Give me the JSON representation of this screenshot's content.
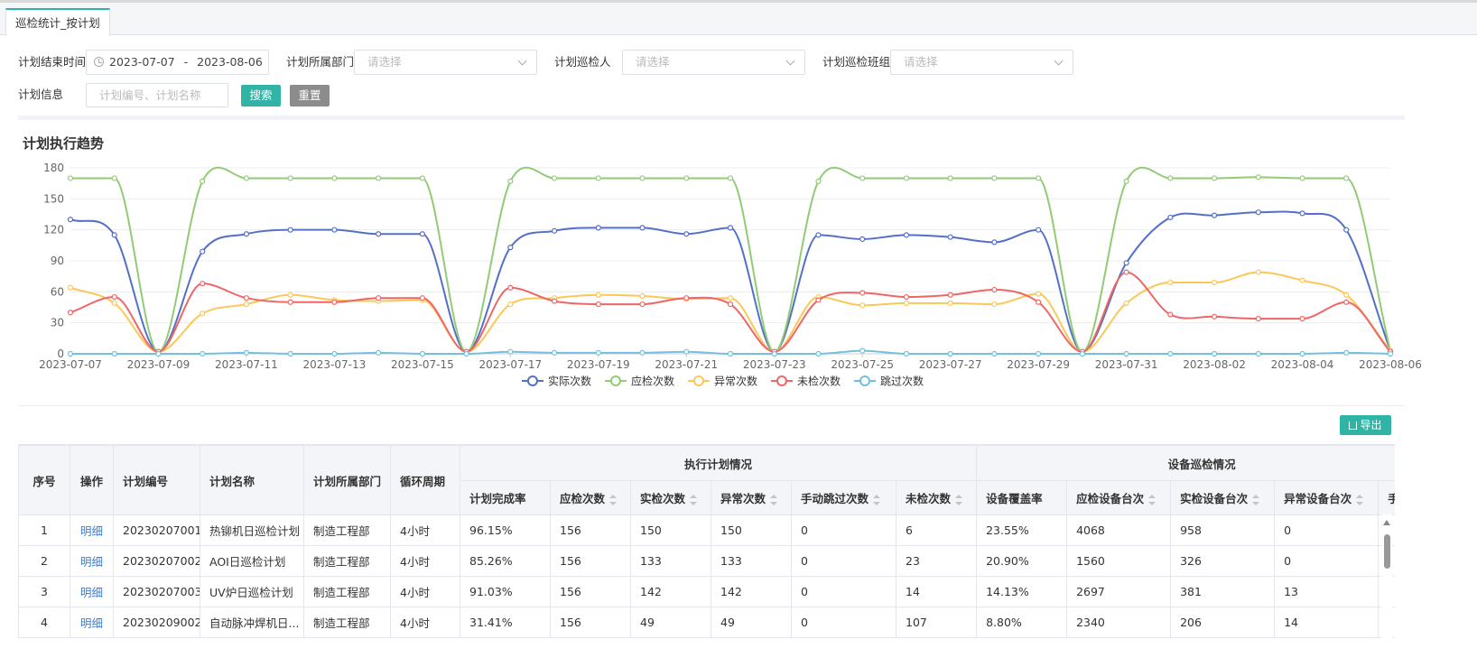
{
  "tab": {
    "label": "巡检统计_按计划"
  },
  "filters": {
    "end_time_label": "计划结束时间",
    "date_start": "2023-07-07",
    "date_sep": "-",
    "date_end": "2023-08-06",
    "dept_label": "计划所属部门",
    "dept_placeholder": "请选择",
    "inspector_label": "计划巡检人",
    "inspector_placeholder": "请选择",
    "team_label": "计划巡检班组",
    "team_placeholder": "请选择",
    "info_label": "计划信息",
    "info_placeholder": "计划编号、计划名称",
    "search_label": "搜索",
    "reset_label": "重置"
  },
  "chart": {
    "title": "计划执行趋势"
  },
  "chart_data": {
    "type": "line",
    "x": [
      "2023-07-07",
      "2023-07-08",
      "2023-07-09",
      "2023-07-10",
      "2023-07-11",
      "2023-07-12",
      "2023-07-13",
      "2023-07-14",
      "2023-07-15",
      "2023-07-16",
      "2023-07-17",
      "2023-07-18",
      "2023-07-19",
      "2023-07-20",
      "2023-07-21",
      "2023-07-22",
      "2023-07-23",
      "2023-07-24",
      "2023-07-25",
      "2023-07-26",
      "2023-07-27",
      "2023-07-28",
      "2023-07-29",
      "2023-07-30",
      "2023-07-31",
      "2023-08-01",
      "2023-08-02",
      "2023-08-03",
      "2023-08-04",
      "2023-08-05",
      "2023-08-06"
    ],
    "x_tick_labels": [
      "2023-07-07",
      "2023-07-09",
      "2023-07-11",
      "2023-07-13",
      "2023-07-15",
      "2023-07-17",
      "2023-07-19",
      "2023-07-21",
      "2023-07-23",
      "2023-07-25",
      "2023-07-27",
      "2023-07-29",
      "2023-07-31",
      "2023-08-02",
      "2023-08-04",
      "2023-08-06"
    ],
    "y_ticks": [
      0,
      30,
      60,
      90,
      120,
      150,
      180
    ],
    "ylim": [
      0,
      180
    ],
    "grid": true,
    "legend_position": "bottom",
    "series": [
      {
        "name": "实际次数",
        "color": "#5470c6",
        "values": [
          130,
          115,
          2,
          99,
          116,
          120,
          120,
          116,
          116,
          2,
          103,
          119,
          122,
          122,
          116,
          122,
          2,
          115,
          111,
          115,
          113,
          108,
          120,
          2,
          88,
          132,
          134,
          137,
          136,
          120,
          3
        ]
      },
      {
        "name": "应检次数",
        "color": "#91cc75",
        "values": [
          170,
          170,
          2,
          167,
          170,
          170,
          170,
          170,
          170,
          2,
          167,
          170,
          170,
          170,
          170,
          170,
          2,
          167,
          170,
          170,
          170,
          170,
          170,
          2,
          167,
          170,
          170,
          171,
          170,
          170,
          3
        ]
      },
      {
        "name": "异常次数",
        "color": "#fac858",
        "values": [
          64,
          49,
          2,
          39,
          48,
          57,
          52,
          51,
          52,
          2,
          48,
          54,
          57,
          56,
          53,
          54,
          2,
          55,
          47,
          49,
          49,
          48,
          58,
          2,
          49,
          69,
          69,
          79,
          71,
          57,
          3
        ]
      },
      {
        "name": "未检次数",
        "color": "#ee6666",
        "values": [
          40,
          55,
          2,
          68,
          54,
          50,
          50,
          54,
          54,
          2,
          64,
          51,
          48,
          48,
          54,
          48,
          2,
          52,
          59,
          55,
          57,
          62,
          50,
          2,
          79,
          38,
          36,
          34,
          34,
          50,
          2
        ]
      },
      {
        "name": "跳过次数",
        "color": "#73c0de",
        "values": [
          0,
          0,
          0,
          0,
          1,
          0,
          0,
          1,
          0,
          0,
          2,
          1,
          1,
          1,
          2,
          0,
          0,
          0,
          3,
          0,
          0,
          0,
          0,
          0,
          0,
          0,
          0,
          0,
          0,
          1,
          0
        ]
      }
    ]
  },
  "toolbar": {
    "export_label": "导出"
  },
  "table": {
    "group_exec": "执行计划情况",
    "group_device": "设备巡检情况",
    "headers": {
      "seq": "序号",
      "op": "操作",
      "code": "计划编号",
      "name": "计划名称",
      "dept": "计划所属部门",
      "cycle": "循环周期",
      "rate": "计划完成率",
      "should": "应检次数",
      "actual": "实检次数",
      "abnormal": "异常次数",
      "skip": "手动跳过次数",
      "miss": "未检次数",
      "cover": "设备覆盖率",
      "dev_should": "应检设备台次",
      "dev_actual": "实检设备台次",
      "dev_abnormal": "异常设备台次",
      "trunc": "手"
    },
    "rows": [
      {
        "seq": "1",
        "op": "明细",
        "code": "20230207001",
        "name": "热铆机日巡检计划",
        "dept": "制造工程部",
        "cycle": "4小时",
        "rate": "96.15%",
        "should": "156",
        "actual": "150",
        "abnormal": "150",
        "skip": "0",
        "miss": "6",
        "cover": "23.55%",
        "dev_should": "4068",
        "dev_actual": "958",
        "dev_abnormal": "0"
      },
      {
        "seq": "2",
        "op": "明细",
        "code": "20230207002",
        "name": "AOI日巡检计划",
        "dept": "制造工程部",
        "cycle": "4小时",
        "rate": "85.26%",
        "should": "156",
        "actual": "133",
        "abnormal": "133",
        "skip": "0",
        "miss": "23",
        "cover": "20.90%",
        "dev_should": "1560",
        "dev_actual": "326",
        "dev_abnormal": "0"
      },
      {
        "seq": "3",
        "op": "明细",
        "code": "20230207003",
        "name": "UV炉日巡检计划",
        "dept": "制造工程部",
        "cycle": "4小时",
        "rate": "91.03%",
        "should": "156",
        "actual": "142",
        "abnormal": "142",
        "skip": "0",
        "miss": "14",
        "cover": "14.13%",
        "dev_should": "2697",
        "dev_actual": "381",
        "dev_abnormal": "13"
      },
      {
        "seq": "4",
        "op": "明细",
        "code": "20230209002",
        "name": "自动脉冲焊机日...",
        "dept": "制造工程部",
        "cycle": "4小时",
        "rate": "31.41%",
        "should": "156",
        "actual": "49",
        "abnormal": "49",
        "skip": "0",
        "miss": "107",
        "cover": "8.80%",
        "dev_should": "2340",
        "dev_actual": "206",
        "dev_abnormal": "14"
      }
    ]
  }
}
